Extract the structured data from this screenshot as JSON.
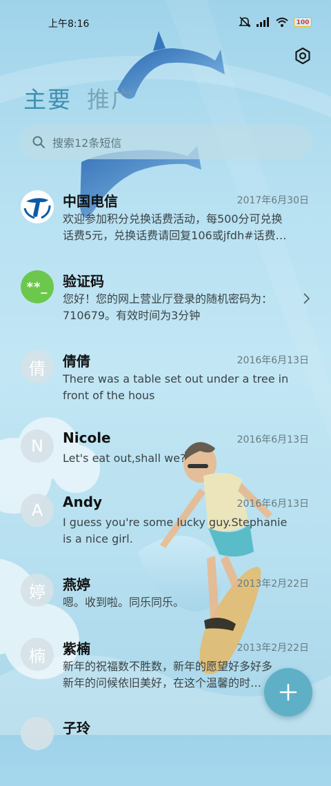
{
  "status_bar": {
    "time": "上午8:16",
    "battery": "100",
    "icons": [
      "mute-icon",
      "signal-icon",
      "wifi-icon",
      "battery-icon"
    ]
  },
  "header": {
    "settings_icon": "gear-icon",
    "tabs": [
      {
        "label": "主要",
        "active": true
      },
      {
        "label": "推广",
        "active": false
      }
    ]
  },
  "search": {
    "placeholder": "搜索12条短信",
    "icon": "search-icon"
  },
  "messages": [
    {
      "sender": "中国电信",
      "date": "2017年6月30日",
      "avatar": "telecom-logo",
      "preview": [
        "欢迎参加积分兑换话费活动，每500分可兑换",
        "话费5元，兑换话费请回复106或jfdh#话费…"
      ]
    },
    {
      "sender": "验证码",
      "date": "",
      "avatar_text": "**_",
      "preview": [
        "您好！您的网上营业厅登录的随机密码为：",
        "710679。有效时间为3分钟"
      ],
      "chevron": "chevron-right-icon"
    },
    {
      "sender": "倩倩",
      "date": "2016年6月13日",
      "avatar_text": "倩",
      "preview": [
        "There was a table set out under a tree in",
        "front of the hous"
      ]
    },
    {
      "sender": "Nicole",
      "date": "2016年6月13日",
      "avatar_text": "N",
      "preview": [
        "Let's eat out,shall we?"
      ]
    },
    {
      "sender": "Andy",
      "date": "2016年6月13日",
      "avatar_text": "A",
      "preview": [
        "I guess you're some lucky guy.Stephanie",
        "is a nice girl."
      ]
    },
    {
      "sender": "燕婷",
      "date": "2013年2月22日",
      "avatar_text": "婷",
      "preview": [
        "嗯。收到啦。同乐同乐。"
      ]
    },
    {
      "sender": "紫楠",
      "date": "2013年2月22日",
      "avatar_text": "楠",
      "preview": [
        "新年的祝福数不胜数，新年的愿望好多好多",
        "新年的问候依旧美好，在这个温馨的时…"
      ]
    },
    {
      "sender": "子玲",
      "date": "",
      "avatar_text": ""
    }
  ],
  "fab": {
    "icon": "plus-icon"
  },
  "theme": {
    "accent": "#3f8fae",
    "fab_color": "#5fb0c7",
    "code_avatar": "#6cc84c",
    "telecom_blue": "#0b5aa7"
  }
}
